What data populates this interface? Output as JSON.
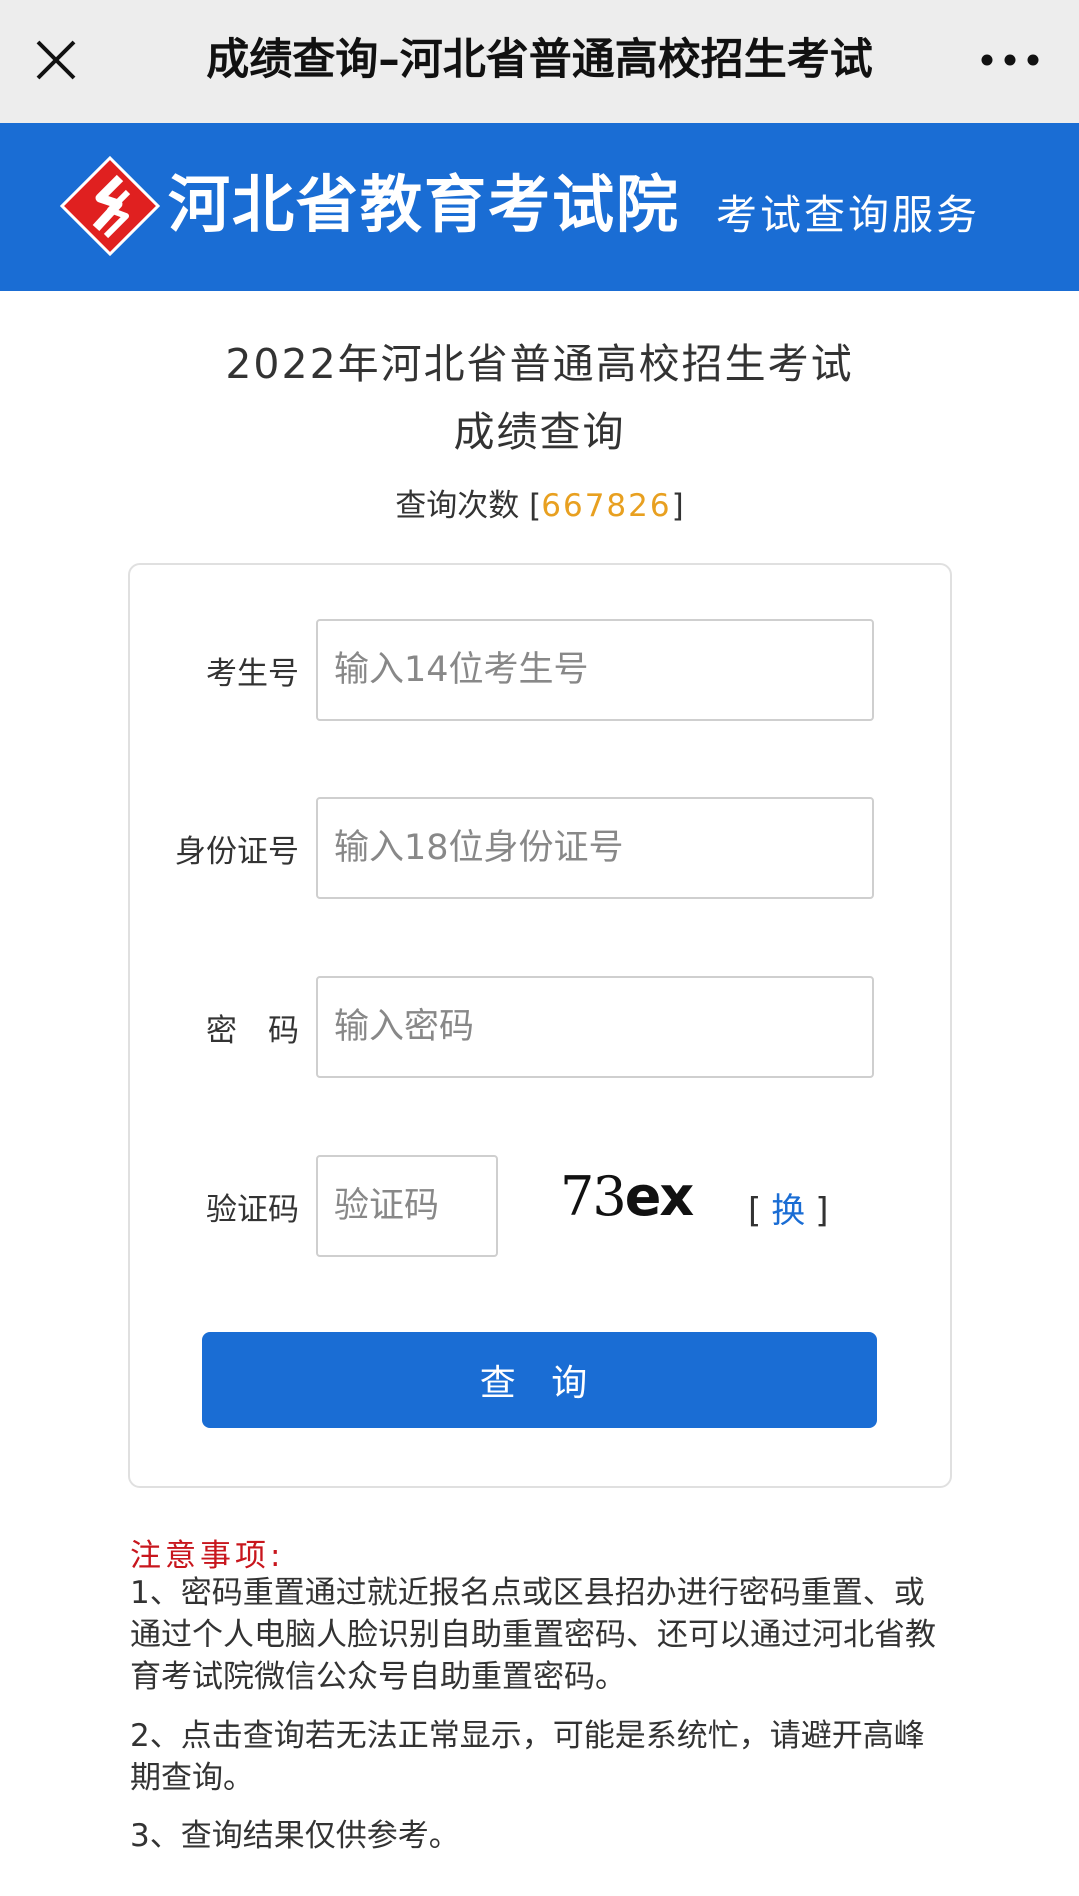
{
  "navbar": {
    "close_icon": "close-icon",
    "title": "成绩查询–河北省普通高校招生考试",
    "more_icon": "more-icon"
  },
  "banner": {
    "logo_icon": "hebei-exam-logo",
    "title": "河北省教育考试院",
    "subtitle": "考试查询服务",
    "background": "#1a6dd4"
  },
  "heading": {
    "line1": "2022年河北省普通高校招生考试",
    "line2": "成绩查询"
  },
  "query_count": {
    "label": "查询次数",
    "open_bracket": "[",
    "value": "667826",
    "close_bracket": "]",
    "value_color": "#e8a020"
  },
  "form": {
    "exam_number": {
      "label": "考生号",
      "placeholder": "输入14位考生号",
      "value": ""
    },
    "id_number": {
      "label": "身份证号",
      "placeholder": "输入18位身份证号",
      "value": ""
    },
    "password": {
      "label": "密　码",
      "placeholder": "输入密码",
      "value": ""
    },
    "captcha": {
      "label": "验证码",
      "placeholder": "验证码",
      "value": "",
      "image_text_a": "73",
      "image_text_b": "ex",
      "refresh_open": "[",
      "refresh_label": "换",
      "refresh_close": "]"
    },
    "submit_label": "查 询"
  },
  "notes": {
    "title": "注意事项:",
    "items": [
      "1、密码重置通过就近报名点或区县招办进行密码重置、或通过个人电脑人脸识别自助重置密码、还可以通过河北省教育考试院微信公众号自助重置密码。",
      "2、点击查询若无法正常显示，可能是系统忙，请避开高峰期查询。",
      "3、查询结果仅供参考。"
    ],
    "title_color": "#c8161d"
  }
}
